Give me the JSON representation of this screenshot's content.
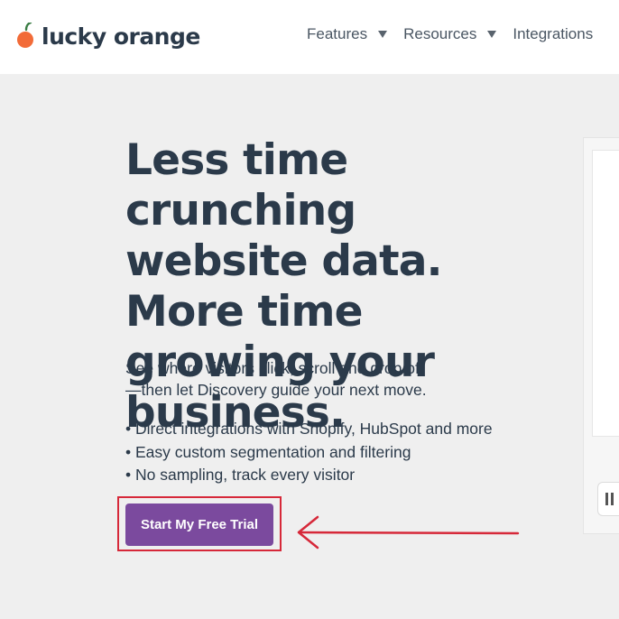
{
  "brand": {
    "name": "lucky orange",
    "icon": "orange-fruit-icon",
    "colors": {
      "orange": "#f26b38",
      "leaf": "#3a7d44",
      "text": "#2b3a4a"
    }
  },
  "nav": {
    "items": [
      {
        "label": "Features",
        "has_dropdown": true
      },
      {
        "label": "Resources",
        "has_dropdown": true
      },
      {
        "label": "Integrations",
        "has_dropdown": false
      }
    ]
  },
  "hero": {
    "headline": "Less time crunching website data. More time growing your business.",
    "subheadline_line1": "See where visitors click, scroll and drop off",
    "subheadline_line2": "—then let Discovery guide your next move.",
    "bullets": [
      "• Direct integrations with Shopify, HubSpot and more",
      "• Easy custom segmentation and filtering",
      "• No sampling, track every visitor"
    ],
    "cta_label": "Start My Free Trial"
  },
  "annotation": {
    "highlight_color": "#d62839",
    "arrow_icon": "left-arrow-icon"
  },
  "colors": {
    "page_bg": "#efefef",
    "header_bg": "#ffffff",
    "cta_bg": "#7b4a9e"
  }
}
